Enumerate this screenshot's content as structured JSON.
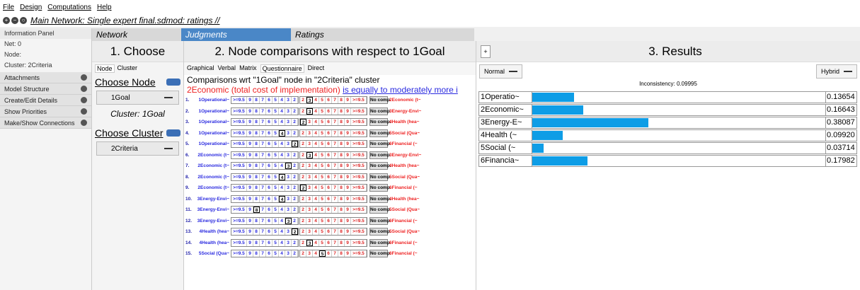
{
  "menu": [
    "File",
    "Design",
    "Computations",
    "Help"
  ],
  "window_title": "Main Network: Single expert final.sdmod: ratings //",
  "left_panel": {
    "header": "Information Panel",
    "net": "Net: 0",
    "node": "Node:",
    "cluster": "Cluster: 2Criteria",
    "buttons": [
      "Attachments",
      "Model Structure",
      "Create/Edit Details",
      "Show Priorities",
      "Make/Show Connections"
    ]
  },
  "tabs": {
    "network": "Network",
    "judgments": "Judgments",
    "ratings": "Ratings"
  },
  "choose": {
    "title": "1. Choose",
    "subtabs": [
      "Node",
      "Cluster"
    ],
    "choose_node_label": "Choose Node",
    "node_value": "1Goal",
    "cluster_text": "Cluster: 1Goal",
    "choose_cluster_label": "Choose Cluster",
    "cluster_value": "2Criteria"
  },
  "comparisons": {
    "title": "2. Node comparisons with respect to 1Goal",
    "mode_tabs": [
      "Graphical",
      "Verbal",
      "Matrix",
      "Questionnaire",
      "Direct"
    ],
    "header": "Comparisons wrt \"1Goal\" node in \"2Criteria\" cluster",
    "verbal_left": "2Economic (total cost of implementation)",
    "verbal_right": "is equally to moderately more i",
    "scale_left": [
      ">=9.5",
      "9",
      "8",
      "7",
      "6",
      "5",
      "4",
      "3",
      "2"
    ],
    "scale_right": [
      "2",
      "3",
      "4",
      "5",
      "6",
      "7",
      "8",
      "9",
      ">=9.5"
    ],
    "no_comp": "No comp.",
    "rows": [
      {
        "num": "1.",
        "left": "1Operational~",
        "right": "2Economic (t~",
        "sel": "R3"
      },
      {
        "num": "2.",
        "left": "1Operational~",
        "right": "3Energy-Envi~",
        "sel": "R3"
      },
      {
        "num": "3.",
        "left": "1Operational~",
        "right": "4Health (hea~",
        "sel": "R2"
      },
      {
        "num": "4.",
        "left": "1Operational~",
        "right": "5Social (Qua~",
        "sel": "L4"
      },
      {
        "num": "5.",
        "left": "1Operational~",
        "right": "6Financial (~",
        "sel": "L2"
      },
      {
        "num": "6.",
        "left": "2Economic (t~",
        "right": "3Energy-Envi~",
        "sel": "R3"
      },
      {
        "num": "7.",
        "left": "2Economic (t~",
        "right": "4Health (hea~",
        "sel": "L3"
      },
      {
        "num": "8.",
        "left": "2Economic (t~",
        "right": "5Social (Qua~",
        "sel": "L4"
      },
      {
        "num": "9.",
        "left": "2Economic (t~",
        "right": "6Financial (~",
        "sel": "R2"
      },
      {
        "num": "10.",
        "left": "3Energy-Envi~",
        "right": "4Health (hea~",
        "sel": "L4"
      },
      {
        "num": "11.",
        "left": "3Energy-Envi~",
        "right": "5Social (Qua~",
        "sel": "L8"
      },
      {
        "num": "12.",
        "left": "3Energy-Envi~",
        "right": "6Financial (~",
        "sel": "L3"
      },
      {
        "num": "13.",
        "left": "4Health (hea~",
        "right": "5Social (Qua~",
        "sel": "L2"
      },
      {
        "num": "14.",
        "left": "4Health (hea~",
        "right": "6Financial (~",
        "sel": "R3"
      },
      {
        "num": "15.",
        "left": "5Social (Qua~",
        "right": "6Financial (~",
        "sel": "R5"
      }
    ]
  },
  "results": {
    "plus": "+",
    "title": "3. Results",
    "mode": "Normal",
    "mode2": "Hybrid",
    "inconsistency": "Inconsistency: 0.09995",
    "items": [
      {
        "label": "1Operatio~",
        "value": "0.13654",
        "v": 0.13654
      },
      {
        "label": "2Economic~",
        "value": "0.16643",
        "v": 0.16643
      },
      {
        "label": "3Energy-E~",
        "value": "0.38087",
        "v": 0.38087
      },
      {
        "label": "4Health (~",
        "value": "0.09920",
        "v": 0.0992
      },
      {
        "label": "5Social (~",
        "value": "0.03714",
        "v": 0.03714
      },
      {
        "label": "6Financia~",
        "value": "0.17982",
        "v": 0.17982
      }
    ],
    "bar_color": "#0e9de6"
  },
  "colors": {
    "judgments_tab": "#4a87c7",
    "rating_blue": "#2a2ae0",
    "rating_red": "#e22222"
  }
}
